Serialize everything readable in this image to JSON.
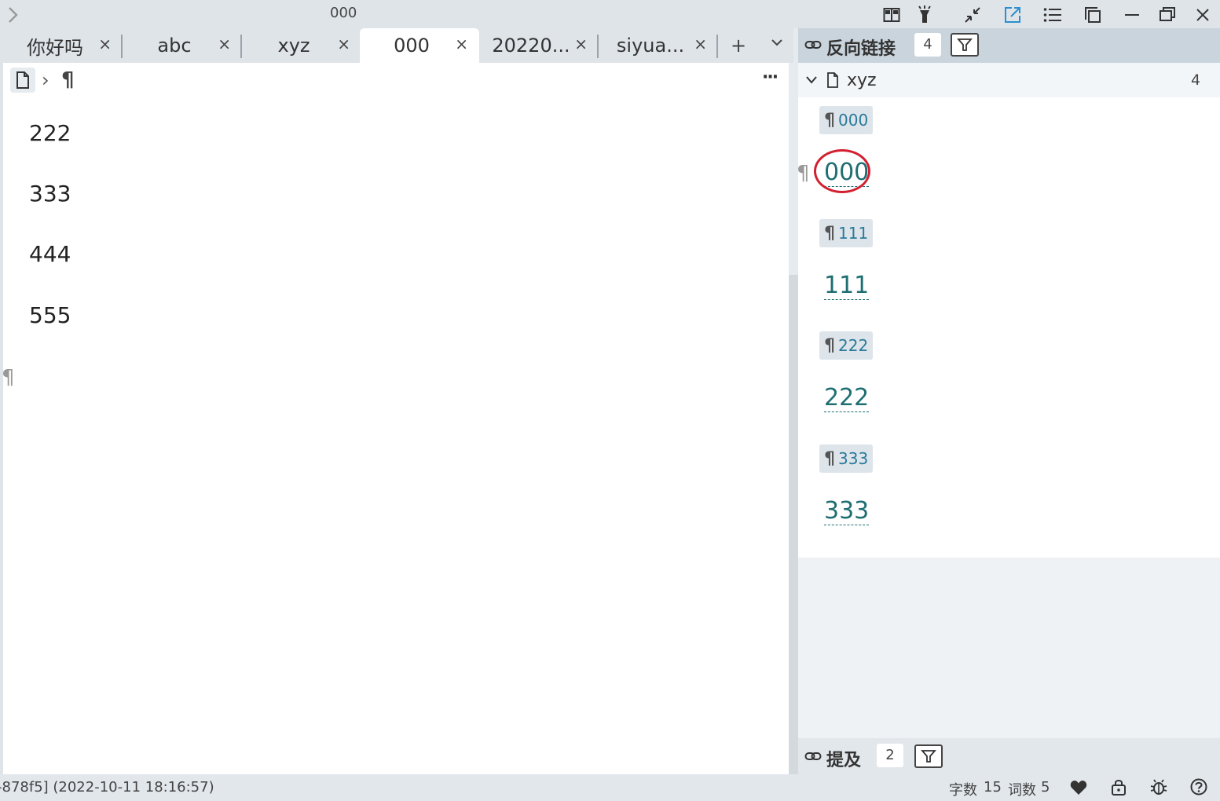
{
  "window": {
    "title": "000"
  },
  "tabs": [
    {
      "label": "你好吗",
      "active": false
    },
    {
      "label": "abc",
      "active": false
    },
    {
      "label": "xyz",
      "active": false
    },
    {
      "label": "000",
      "active": true
    },
    {
      "label": "20220...",
      "active": false
    },
    {
      "label": "siyua...",
      "active": false
    }
  ],
  "tab_controls": {
    "add": "+",
    "more": "⌄",
    "close": "×"
  },
  "editor": {
    "breadcrumb_sep": "›",
    "breadcrumb_block": "¶",
    "more": "···",
    "paragraphs": [
      "222",
      "333",
      "444",
      "555"
    ],
    "block_marker": "¶"
  },
  "backlinks": {
    "title": "反向链接",
    "count": "4",
    "group_name": "xyz",
    "group_count": "4",
    "items": [
      {
        "crumb": "000",
        "text": "000",
        "highlighted": true
      },
      {
        "crumb": "111",
        "text": "111",
        "highlighted": false
      },
      {
        "crumb": "222",
        "text": "222",
        "highlighted": false
      },
      {
        "crumb": "333",
        "text": "333",
        "highlighted": false
      }
    ],
    "block_marker": "¶"
  },
  "mentions": {
    "title": "提及",
    "count": "2"
  },
  "statusbar": {
    "left": "-878f5] (2022-10-11 18:16:57)",
    "char_label": "字数",
    "char_count": "15",
    "word_label": "词数",
    "word_count": "5"
  },
  "colors": {
    "accent": "#2a7a9a",
    "ref_text": "#1f6e72",
    "highlight_circle": "#d22030"
  }
}
